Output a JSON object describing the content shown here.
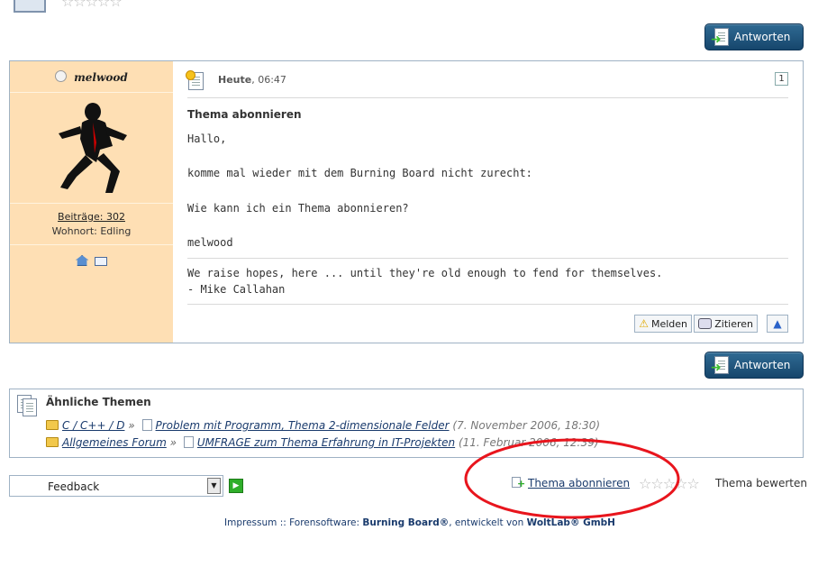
{
  "buttons": {
    "answer_top": "Antworten",
    "answer_bottom": "Antworten"
  },
  "post": {
    "username": "melwood",
    "date_label": "Heute",
    "time": ", 06:47",
    "post_number": "1",
    "title": "Thema abonnieren",
    "body_lines": [
      "Hallo,",
      "komme mal wieder mit dem Burning Board nicht zurecht:",
      "Wie kann ich ein Thema abonnieren?",
      "melwood"
    ],
    "signature_lines": [
      "We raise hopes, here ... until they're old enough to fend for themselves.",
      "- Mike Callahan"
    ],
    "posts_count": "Beiträge: 302",
    "location": "Wohnort: Edling",
    "actions": {
      "report": "Melden",
      "quote": "Zitieren"
    }
  },
  "similar": {
    "heading": "Ähnliche Themen",
    "items": [
      {
        "forum": "C / C++ / D",
        "topic": "Problem mit Programm, Thema 2-dimensionale Felder",
        "date": "(7. November 2006, 18:30)"
      },
      {
        "forum": "Allgemeines Forum",
        "topic": "UMFRAGE zum Thema Erfahrung in IT-Projekten",
        "date": "(11. Februar 2006, 12:39)"
      }
    ]
  },
  "bottom": {
    "select_value": "Feedback",
    "subscribe": "Thema abonnieren",
    "rate": "Thema bewerten"
  },
  "footer": {
    "prefix": "Impressum :: Forensoftware: ",
    "product": "Burning Board®",
    "middle": ", entwickelt von ",
    "company": "WoltLab® GmbH"
  },
  "colors": {
    "sidebar": "#fedfb4",
    "button": "#1d4f77",
    "annotation": "#e8151d"
  }
}
